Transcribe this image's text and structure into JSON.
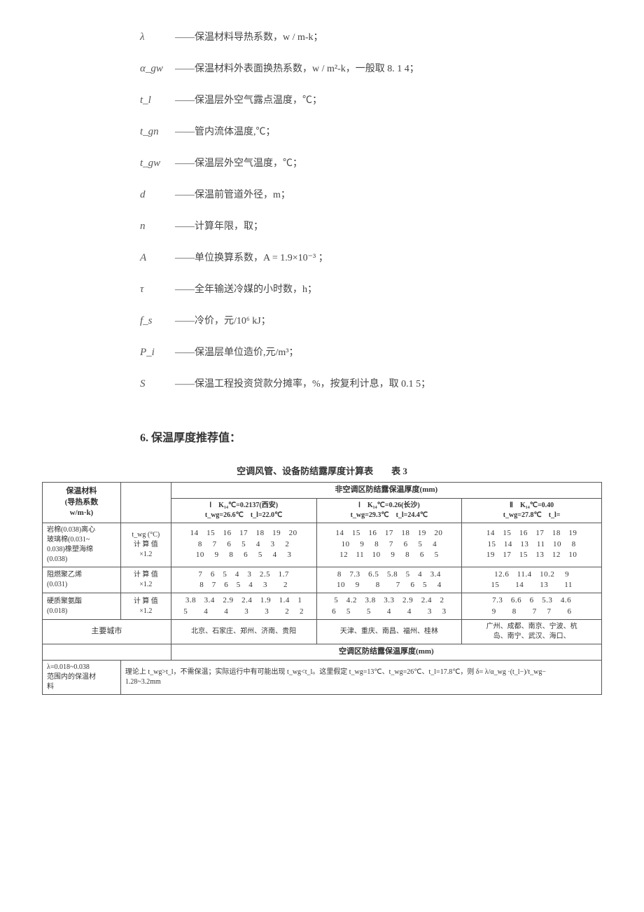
{
  "definitions": [
    {
      "symbol": "λ",
      "text": "——保温材料导热系数，w / m-k；"
    },
    {
      "symbol": "α_gw",
      "text": "——保温材料外表面换热系数，w / m²-k，一般取 8. 1 4；"
    },
    {
      "symbol": "t_l",
      "text": "——保温层外空气露点温度，℃；"
    },
    {
      "symbol": "t_gn",
      "text": "——管内流体温度,℃；"
    },
    {
      "symbol": "t_gw",
      "text": "——保温层外空气温度，℃；"
    },
    {
      "symbol": "d",
      "text": "——保温前管道外径，m；"
    },
    {
      "symbol": "n",
      "text": "——计算年限，取；"
    },
    {
      "symbol": "A",
      "text": "——单位换算系数，A = 1.9×10⁻³ ；"
    },
    {
      "symbol": "τ",
      "text": "——全年输送冷媒的小时数，h；"
    },
    {
      "symbol": "f_s",
      "text": "——冷价，元/10⁶ kJ；"
    },
    {
      "symbol": "P_i",
      "text": "——保温层单位造价,元/m³；"
    },
    {
      "symbol": "S",
      "text": "——保温工程投资贷款分摊率，%，按复利计息，取 0.1 5；"
    }
  ],
  "section_heading": "6. 保温厚度推荐值：",
  "table_title": "空调风管、设备防结露厚度计算表　　表 3",
  "table": {
    "h_material": "保温材料\n(导热系数\nw/m·k)",
    "h_nonac": "非空调区防结露保温厚度(mm)",
    "h_col1": "Ⅰ　K₁₄℃=0.2137(西安)\nt_wg=26.6℃　t_l=22.0℃",
    "h_col2": "Ⅰ　K₁₄℃=0.26(长沙)\nt_wg=29.3℃　t_l=24.4℃",
    "h_col3": "Ⅱ　K₁₄℃=0.40\nt_wg=27.8℃　t_l=",
    "rows": [
      {
        "mat": "岩棉(0.038)离心\n玻璃棉(0.031~\n0.038)橡塑海绵\n(0.038)",
        "label": "t_wg (°C)\n计 算 值\n×1.2",
        "c1": [
          "14　15　16　17　18　19　20",
          "8　 7　 6　 5　 4　 3　 2",
          "10　 9　 8　 6　 5　 4　 3"
        ],
        "c2": [
          "14　15　16　17　18　19　20",
          "10　 9　 8　 7　 6　 5　 4",
          "12　11　10　 9　 8　 6　 5"
        ],
        "c3": [
          "14　15　16　17　18　19",
          "15　14　13　11　10　 8",
          "19　17　15　13　12　10"
        ]
      },
      {
        "mat": "阻燃聚乙烯\n(0.031)",
        "label": "计 算 值\n×1.2",
        "c1": [
          "7　6　5　4　3　2.5　1.7",
          "8　7　6　5　4　 3　　2"
        ],
        "c2": [
          "8　7.3　6.5　5.8　5　4　3.4",
          "10　 9　　8　　7　 6　5　 4"
        ],
        "c3": [
          "12.6　11.4　10.2　 9　",
          "15　　14　　13　　11　"
        ]
      },
      {
        "mat": "硬质聚氨酯\n(0.018)",
        "label": "计 算 值\n×1.2",
        "c1": [
          "3.8　3.4　2.9　2.4　1.9　1.4　1",
          "5　　4　　4　　3　　3　　2　 2"
        ],
        "c2": [
          "5　4.2　3.8　3.3　2.9　2.4　2",
          "6　 5　　5　　4　　4　　3　 3"
        ],
        "c3": [
          "7.3　6.6　6　5.3　4.6",
          "9　　8　　7　 7　　6"
        ]
      }
    ],
    "cities_label": "主要城市",
    "cities": [
      "北京、石家庄、郑州、济南、贵阳",
      "天津、重庆、南昌、福州、桂林",
      "广州、成都、南京、宁波、杭\n岛、南宁、武汉、海口、"
    ],
    "h_ac": "空调区防结露保温厚度(mm)",
    "foot_mat": "λ=0.018~0.038\n范围内的保温材\n料",
    "foot_text": "理论上 t_wg>t_l，不需保温；实际运行中有可能出现 t_wg<t_l。这里假定 t_wg=13℃、t_wg=26℃、t_l=17.8℃，则 δ= λ/α_wg ·(t_l−)/t_wg−",
    "foot_val": "1.28~3.2mm"
  }
}
